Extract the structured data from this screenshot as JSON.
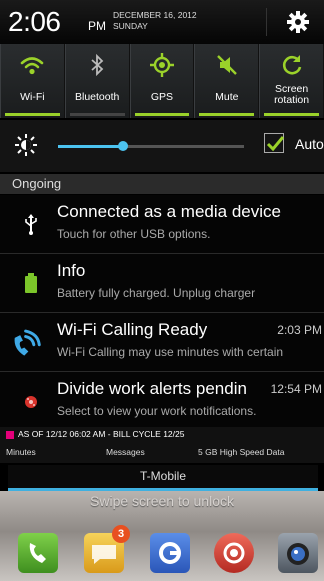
{
  "status": {
    "time": "2:06",
    "ampm": "PM",
    "date_line1": "DECEMBER 16, 2012",
    "date_line2": "SUNDAY",
    "settings_icon": "gear-icon"
  },
  "toggles": [
    {
      "label": "Wi-Fi",
      "icon": "wifi-icon",
      "state": "on"
    },
    {
      "label": "Bluetooth",
      "icon": "bluetooth-icon",
      "state": "off"
    },
    {
      "label": "GPS",
      "icon": "gps-icon",
      "state": "on"
    },
    {
      "label": "Mute",
      "icon": "mute-icon",
      "state": "on"
    },
    {
      "label": "Screen rotation",
      "icon": "rotation-icon",
      "state": "on"
    }
  ],
  "brightness": {
    "icon": "brightness-icon",
    "level": 0.35,
    "auto_checked": true,
    "auto_label": "Auto"
  },
  "section_label": "Ongoing",
  "notifications": [
    {
      "icon": "usb-icon",
      "title": "Connected as a media device",
      "text": "Touch for other USB options.",
      "time": ""
    },
    {
      "icon": "battery-icon",
      "title": "Info",
      "text": "Battery fully charged. Unplug charger",
      "time": ""
    },
    {
      "icon": "wifi-calling-icon",
      "title": "Wi-Fi Calling Ready",
      "text": "Wi-Fi Calling may use minutes with certain",
      "time": "2:03 PM"
    },
    {
      "icon": "work-alert-icon",
      "title": "Divide work alerts pendin",
      "text": "Select to view your work notifications.",
      "time": "12:54 PM"
    }
  ],
  "bill": {
    "header": "AS OF  12/12 06:02 AM - BILL CYCLE 12/25",
    "col_minutes": "Minutes",
    "col_messages": "Messages",
    "col_data": "5 GB High Speed Data"
  },
  "carrier": "T-Mobile",
  "lockscreen": {
    "swipe_text": "Swipe screen to unlock",
    "dock_badge": "3",
    "apps": [
      "phone-icon",
      "messages-icon",
      "google-icon",
      "camera-icon",
      "lens-icon"
    ]
  },
  "colors": {
    "toggle_on": "#9bd22a",
    "accent_blue": "#4cc3f0"
  }
}
